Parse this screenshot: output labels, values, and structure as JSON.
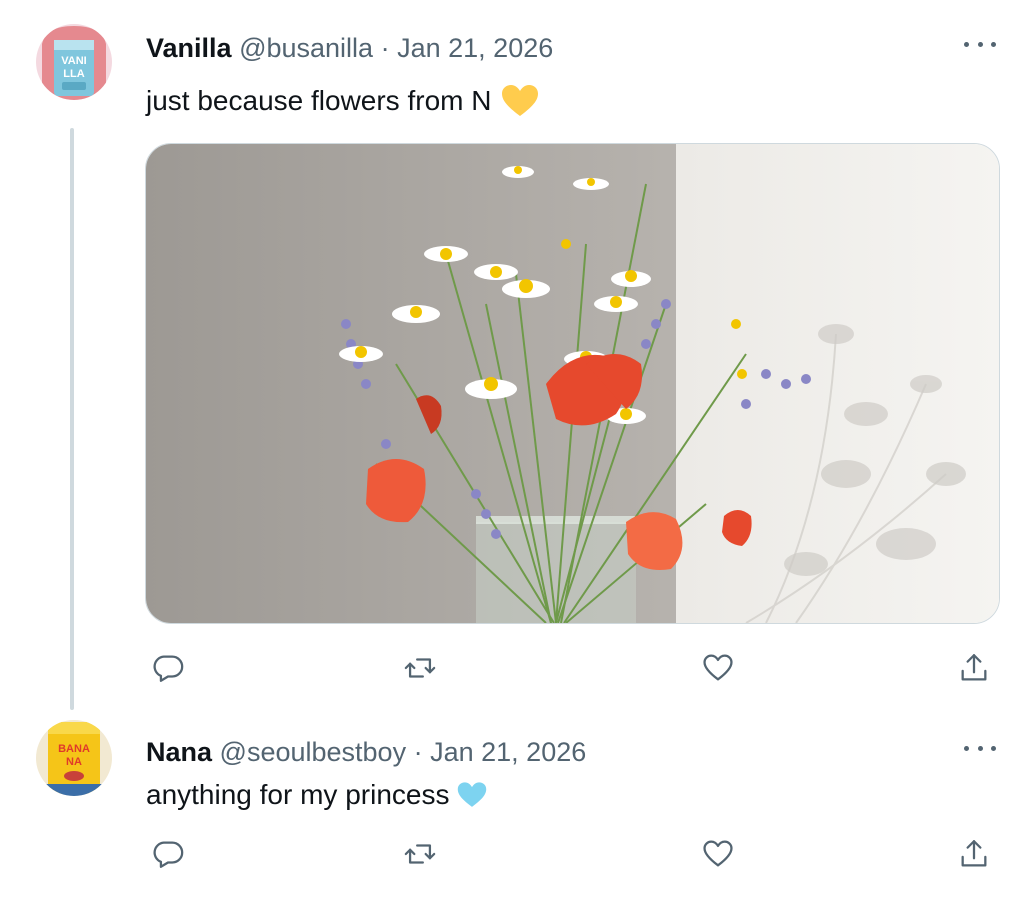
{
  "thread": [
    {
      "name": "Vanilla",
      "handle": "@busanilla",
      "separator": "·",
      "date": "Jan 21, 2026",
      "text": "just because flowers from N",
      "emoji": "yellow-heart",
      "has_media": true,
      "avatar_label_text": "VANILLA"
    },
    {
      "name": "Nana",
      "handle": "@seoulbestboy",
      "separator": "·",
      "date": "Jan 21, 2026",
      "text": "anything for my princess",
      "emoji": "light-blue-heart",
      "has_media": false,
      "avatar_label_text": "BANANA"
    }
  ],
  "icons": [
    "reply-icon",
    "retweet-icon",
    "like-icon",
    "share-icon",
    "more-icon"
  ],
  "colors": {
    "secondary_text": "#536471",
    "thread_line": "#cfd9de",
    "yellow_heart": "#ffcc4d",
    "light_blue_heart": "#7dd3f0"
  }
}
